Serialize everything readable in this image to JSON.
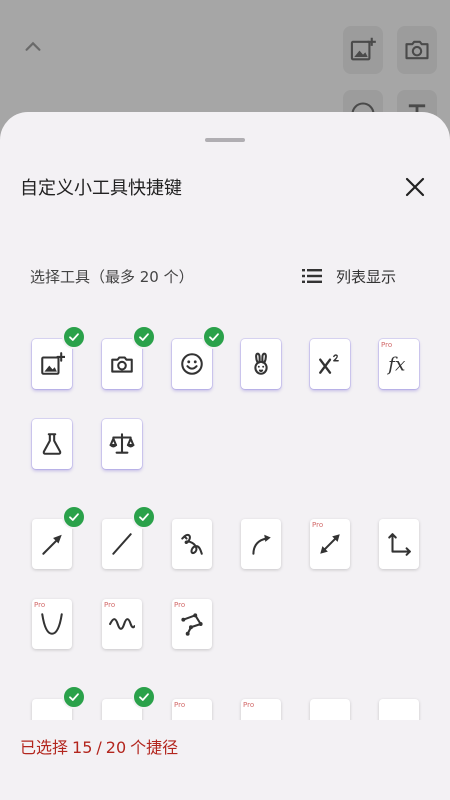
{
  "sheet": {
    "title": "自定义小工具快捷键",
    "section_label": "选择工具（最多 20 个）",
    "view_toggle_label": "列表显示",
    "pro_label": "Pro"
  },
  "footer": {
    "prefix": "已选择",
    "selected": "15",
    "separator": "/",
    "max": "20",
    "suffix": "个捷径"
  },
  "colors": {
    "accent_check": "#2aa14a",
    "footer_text": "#b3261e",
    "pro_text": "#d26a6a",
    "sheet_bg": "#f3f1f4"
  },
  "tools": [
    {
      "icon": "add-image-icon",
      "selected": true,
      "pro": false
    },
    {
      "icon": "camera-icon",
      "selected": true,
      "pro": false
    },
    {
      "icon": "smiley-icon",
      "selected": true,
      "pro": false
    },
    {
      "icon": "rabbit-icon",
      "selected": false,
      "pro": false
    },
    {
      "icon": "superscript-icon",
      "selected": false,
      "pro": false
    },
    {
      "icon": "function-icon",
      "selected": false,
      "pro": true
    },
    {
      "icon": "flask-icon",
      "selected": false,
      "pro": false
    },
    {
      "icon": "balance-scale-icon",
      "selected": false,
      "pro": false
    },
    {
      "icon": "arrow-icon",
      "selected": true,
      "pro": false
    },
    {
      "icon": "line-icon",
      "selected": true,
      "pro": false
    },
    {
      "icon": "freehand-loop-icon",
      "selected": false,
      "pro": false
    },
    {
      "icon": "curved-arrow-icon",
      "selected": false,
      "pro": false
    },
    {
      "icon": "double-arrow-icon",
      "selected": false,
      "pro": true
    },
    {
      "icon": "axes-icon",
      "selected": false,
      "pro": false
    },
    {
      "icon": "parabola-icon",
      "selected": false,
      "pro": true
    },
    {
      "icon": "wave-icon",
      "selected": false,
      "pro": true
    },
    {
      "icon": "polyline-icon",
      "selected": false,
      "pro": true
    },
    {
      "icon": "ellipse-icon",
      "selected": true,
      "pro": false
    },
    {
      "icon": "rectangle-icon",
      "selected": true,
      "pro": false
    },
    {
      "icon": "angle-icon",
      "selected": false,
      "pro": true
    },
    {
      "icon": "triangle-icon",
      "selected": false,
      "pro": true
    },
    {
      "icon": "square-icon",
      "selected": false,
      "pro": false
    },
    {
      "icon": "circle-icon",
      "selected": false,
      "pro": false
    }
  ]
}
